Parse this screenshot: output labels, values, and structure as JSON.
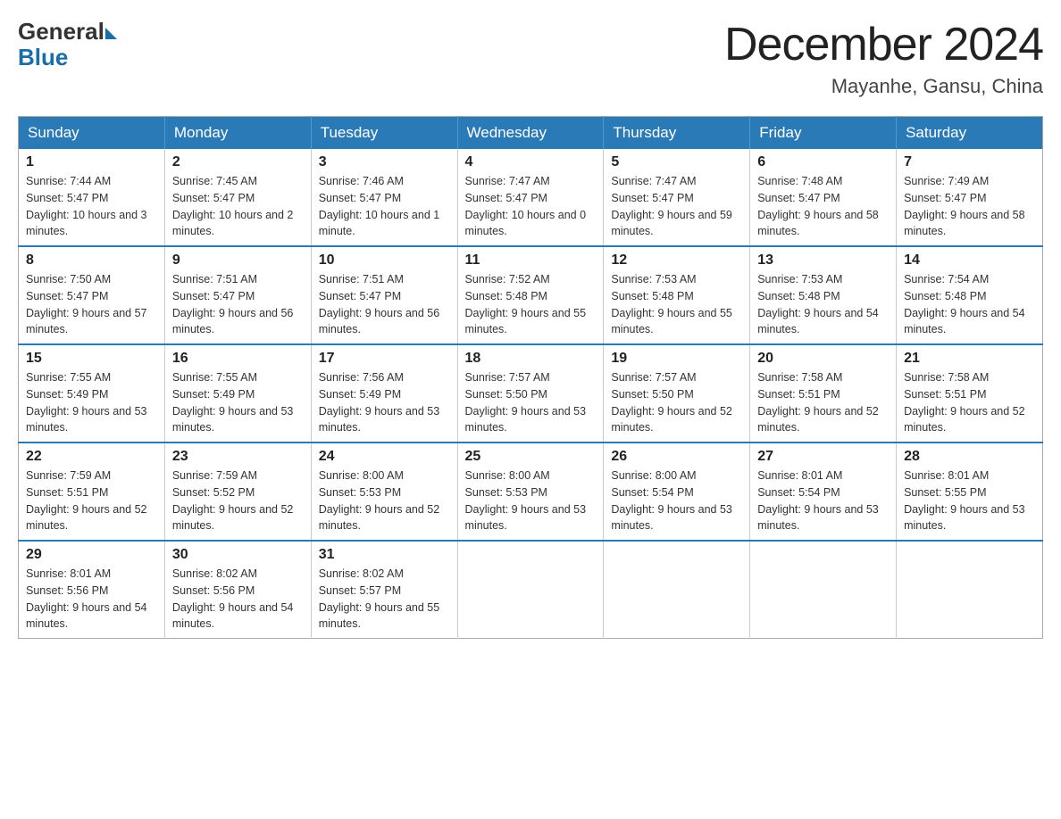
{
  "header": {
    "month_title": "December 2024",
    "location": "Mayanhe, Gansu, China"
  },
  "logo": {
    "general": "General",
    "blue": "Blue"
  },
  "days_of_week": [
    "Sunday",
    "Monday",
    "Tuesday",
    "Wednesday",
    "Thursday",
    "Friday",
    "Saturday"
  ],
  "weeks": [
    [
      {
        "day": "1",
        "sunrise": "Sunrise: 7:44 AM",
        "sunset": "Sunset: 5:47 PM",
        "daylight": "Daylight: 10 hours and 3 minutes."
      },
      {
        "day": "2",
        "sunrise": "Sunrise: 7:45 AM",
        "sunset": "Sunset: 5:47 PM",
        "daylight": "Daylight: 10 hours and 2 minutes."
      },
      {
        "day": "3",
        "sunrise": "Sunrise: 7:46 AM",
        "sunset": "Sunset: 5:47 PM",
        "daylight": "Daylight: 10 hours and 1 minute."
      },
      {
        "day": "4",
        "sunrise": "Sunrise: 7:47 AM",
        "sunset": "Sunset: 5:47 PM",
        "daylight": "Daylight: 10 hours and 0 minutes."
      },
      {
        "day": "5",
        "sunrise": "Sunrise: 7:47 AM",
        "sunset": "Sunset: 5:47 PM",
        "daylight": "Daylight: 9 hours and 59 minutes."
      },
      {
        "day": "6",
        "sunrise": "Sunrise: 7:48 AM",
        "sunset": "Sunset: 5:47 PM",
        "daylight": "Daylight: 9 hours and 58 minutes."
      },
      {
        "day": "7",
        "sunrise": "Sunrise: 7:49 AM",
        "sunset": "Sunset: 5:47 PM",
        "daylight": "Daylight: 9 hours and 58 minutes."
      }
    ],
    [
      {
        "day": "8",
        "sunrise": "Sunrise: 7:50 AM",
        "sunset": "Sunset: 5:47 PM",
        "daylight": "Daylight: 9 hours and 57 minutes."
      },
      {
        "day": "9",
        "sunrise": "Sunrise: 7:51 AM",
        "sunset": "Sunset: 5:47 PM",
        "daylight": "Daylight: 9 hours and 56 minutes."
      },
      {
        "day": "10",
        "sunrise": "Sunrise: 7:51 AM",
        "sunset": "Sunset: 5:47 PM",
        "daylight": "Daylight: 9 hours and 56 minutes."
      },
      {
        "day": "11",
        "sunrise": "Sunrise: 7:52 AM",
        "sunset": "Sunset: 5:48 PM",
        "daylight": "Daylight: 9 hours and 55 minutes."
      },
      {
        "day": "12",
        "sunrise": "Sunrise: 7:53 AM",
        "sunset": "Sunset: 5:48 PM",
        "daylight": "Daylight: 9 hours and 55 minutes."
      },
      {
        "day": "13",
        "sunrise": "Sunrise: 7:53 AM",
        "sunset": "Sunset: 5:48 PM",
        "daylight": "Daylight: 9 hours and 54 minutes."
      },
      {
        "day": "14",
        "sunrise": "Sunrise: 7:54 AM",
        "sunset": "Sunset: 5:48 PM",
        "daylight": "Daylight: 9 hours and 54 minutes."
      }
    ],
    [
      {
        "day": "15",
        "sunrise": "Sunrise: 7:55 AM",
        "sunset": "Sunset: 5:49 PM",
        "daylight": "Daylight: 9 hours and 53 minutes."
      },
      {
        "day": "16",
        "sunrise": "Sunrise: 7:55 AM",
        "sunset": "Sunset: 5:49 PM",
        "daylight": "Daylight: 9 hours and 53 minutes."
      },
      {
        "day": "17",
        "sunrise": "Sunrise: 7:56 AM",
        "sunset": "Sunset: 5:49 PM",
        "daylight": "Daylight: 9 hours and 53 minutes."
      },
      {
        "day": "18",
        "sunrise": "Sunrise: 7:57 AM",
        "sunset": "Sunset: 5:50 PM",
        "daylight": "Daylight: 9 hours and 53 minutes."
      },
      {
        "day": "19",
        "sunrise": "Sunrise: 7:57 AM",
        "sunset": "Sunset: 5:50 PM",
        "daylight": "Daylight: 9 hours and 52 minutes."
      },
      {
        "day": "20",
        "sunrise": "Sunrise: 7:58 AM",
        "sunset": "Sunset: 5:51 PM",
        "daylight": "Daylight: 9 hours and 52 minutes."
      },
      {
        "day": "21",
        "sunrise": "Sunrise: 7:58 AM",
        "sunset": "Sunset: 5:51 PM",
        "daylight": "Daylight: 9 hours and 52 minutes."
      }
    ],
    [
      {
        "day": "22",
        "sunrise": "Sunrise: 7:59 AM",
        "sunset": "Sunset: 5:51 PM",
        "daylight": "Daylight: 9 hours and 52 minutes."
      },
      {
        "day": "23",
        "sunrise": "Sunrise: 7:59 AM",
        "sunset": "Sunset: 5:52 PM",
        "daylight": "Daylight: 9 hours and 52 minutes."
      },
      {
        "day": "24",
        "sunrise": "Sunrise: 8:00 AM",
        "sunset": "Sunset: 5:53 PM",
        "daylight": "Daylight: 9 hours and 52 minutes."
      },
      {
        "day": "25",
        "sunrise": "Sunrise: 8:00 AM",
        "sunset": "Sunset: 5:53 PM",
        "daylight": "Daylight: 9 hours and 53 minutes."
      },
      {
        "day": "26",
        "sunrise": "Sunrise: 8:00 AM",
        "sunset": "Sunset: 5:54 PM",
        "daylight": "Daylight: 9 hours and 53 minutes."
      },
      {
        "day": "27",
        "sunrise": "Sunrise: 8:01 AM",
        "sunset": "Sunset: 5:54 PM",
        "daylight": "Daylight: 9 hours and 53 minutes."
      },
      {
        "day": "28",
        "sunrise": "Sunrise: 8:01 AM",
        "sunset": "Sunset: 5:55 PM",
        "daylight": "Daylight: 9 hours and 53 minutes."
      }
    ],
    [
      {
        "day": "29",
        "sunrise": "Sunrise: 8:01 AM",
        "sunset": "Sunset: 5:56 PM",
        "daylight": "Daylight: 9 hours and 54 minutes."
      },
      {
        "day": "30",
        "sunrise": "Sunrise: 8:02 AM",
        "sunset": "Sunset: 5:56 PM",
        "daylight": "Daylight: 9 hours and 54 minutes."
      },
      {
        "day": "31",
        "sunrise": "Sunrise: 8:02 AM",
        "sunset": "Sunset: 5:57 PM",
        "daylight": "Daylight: 9 hours and 55 minutes."
      },
      null,
      null,
      null,
      null
    ]
  ]
}
